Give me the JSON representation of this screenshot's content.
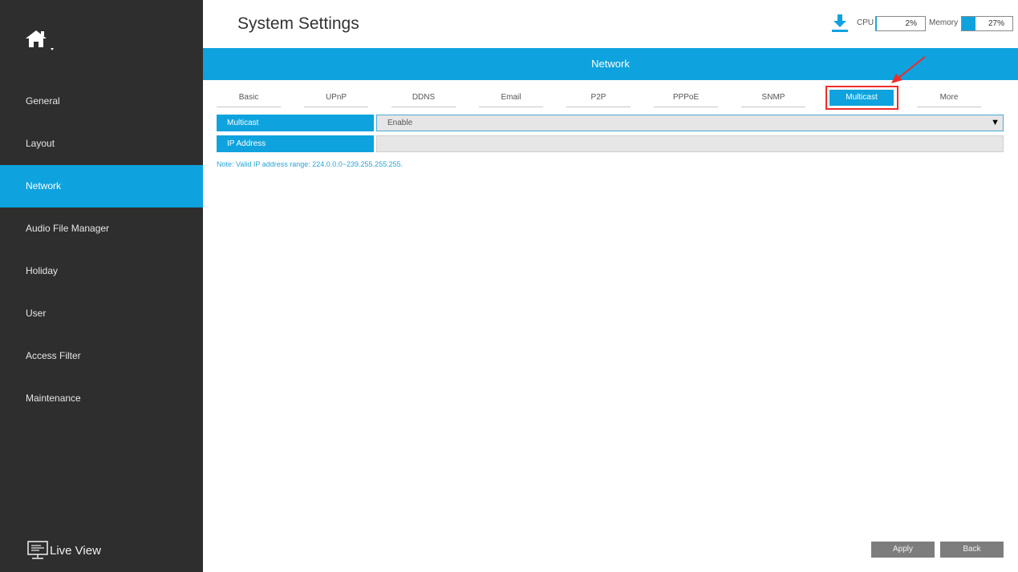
{
  "header": {
    "title": "System Settings",
    "cpu_label": "CPU",
    "cpu_value": "2%",
    "cpu_fraction": 0.02,
    "memory_label": "Memory",
    "memory_value": "27%",
    "memory_fraction": 0.27
  },
  "sidebar": {
    "items": [
      {
        "label": "General"
      },
      {
        "label": "Layout"
      },
      {
        "label": "Network"
      },
      {
        "label": "Audio File Manager"
      },
      {
        "label": "Holiday"
      },
      {
        "label": "User"
      },
      {
        "label": "Access Filter"
      },
      {
        "label": "Maintenance"
      }
    ],
    "active": "Network",
    "live_view_label": "Live View"
  },
  "section": {
    "title": "Network"
  },
  "tabs": [
    {
      "label": "Basic"
    },
    {
      "label": "UPnP"
    },
    {
      "label": "DDNS"
    },
    {
      "label": "Email"
    },
    {
      "label": "P2P"
    },
    {
      "label": "PPPoE"
    },
    {
      "label": "SNMP"
    },
    {
      "label": "Multicast"
    },
    {
      "label": "More"
    }
  ],
  "active_tab": "Multicast",
  "form": {
    "multicast_label": "Multicast",
    "multicast_value": "Enable",
    "ip_label": "IP Address",
    "ip_value": "",
    "note": "Note: Valid IP address range: 224.0.0.0~239.255.255.255."
  },
  "buttons": {
    "apply": "Apply",
    "back": "Back"
  },
  "colors": {
    "accent": "#0ea3de",
    "sidebar": "#2e2e2e",
    "highlight": "#ee2c2c",
    "button": "#7d7d7d"
  }
}
